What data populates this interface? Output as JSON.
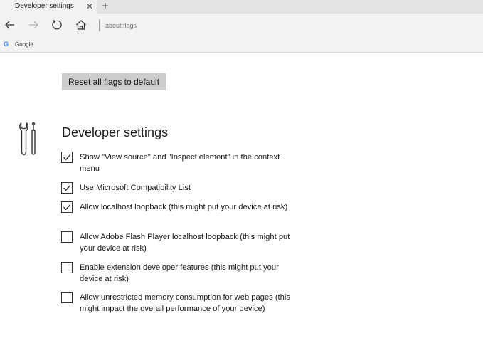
{
  "tab": {
    "title": "Developer settings",
    "close_glyph": "✕",
    "new_tab_glyph": "+"
  },
  "nav": {
    "back_icon": "back-arrow-icon",
    "forward_icon": "forward-arrow-icon",
    "refresh_icon": "refresh-icon",
    "home_icon": "home-icon",
    "address_value": "",
    "address_placeholder": "about:flags"
  },
  "favorites": {
    "items": [
      {
        "icon": "google-icon",
        "icon_glyph": "G",
        "label": "Google"
      }
    ]
  },
  "main": {
    "reset_button_label": "Reset all flags to default",
    "section_icon": "developer-tools-icon",
    "section_heading": "Developer settings",
    "flags": [
      {
        "label": "Show \"View source\" and \"Inspect element\" in the context menu",
        "checked": true
      },
      {
        "label": "Use Microsoft Compatibility List",
        "checked": true
      },
      {
        "label": "Allow localhost loopback (this might put your device at risk)",
        "checked": true
      },
      {
        "label": "Allow Adobe Flash Player localhost loopback (this might put your device at risk)",
        "checked": false
      },
      {
        "label": "Enable extension developer features (this might put your device at risk)",
        "checked": false
      },
      {
        "label": "Allow unrestricted memory consumption for web pages (this might impact the overall performance of your device)",
        "checked": false
      }
    ]
  },
  "colors": {
    "chrome_background": "#f2f2f2",
    "tab_strip_background": "#e4e4e4",
    "button_background": "#cccccc",
    "text": "#1a1a1a",
    "address_text": "#7a7a7a"
  }
}
